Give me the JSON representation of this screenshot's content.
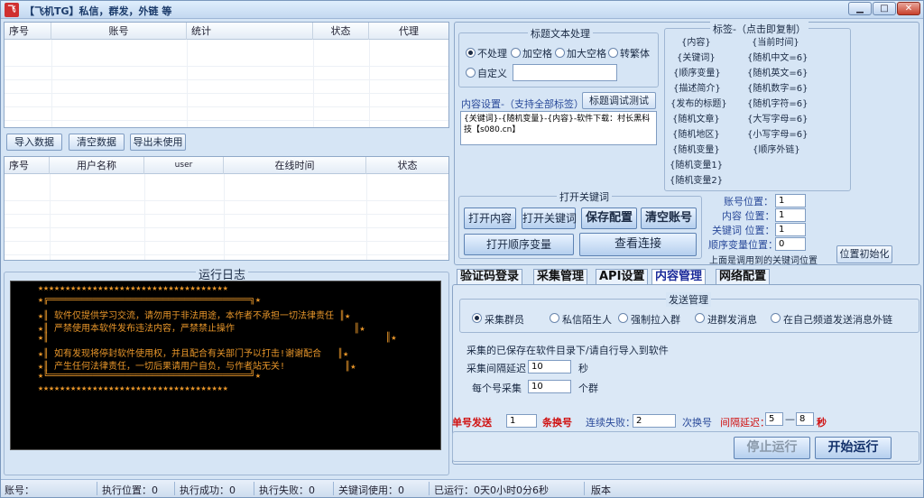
{
  "window": {
    "title": "【飞机TG】私信，群发，外链 等",
    "icon": "飞",
    "min": "▁",
    "max": "□",
    "close": "✕"
  },
  "grid1": {
    "columns": [
      "序号",
      "账号",
      "统计",
      "状态",
      "代理"
    ]
  },
  "grid1_buttons": {
    "import": "导入数据",
    "clear": "清空数据",
    "export": "导出未使用"
  },
  "grid2": {
    "columns": [
      "序号",
      "用户名称",
      "user",
      "在线时间",
      "状态"
    ]
  },
  "log": {
    "title": "运行日志",
    "lines": [
      "★★★★★★★★★★★★★★★★★★★★★★★★★★★★★★★★★★★",
      "★╔═════════════════════════════════════╗★",
      "★║ 软件仅提供学习交流，请勿用于非法用途，本作者不承担一切法律责任 ║★",
      "★║ 严禁使用本软件发布违法内容，严禁禁止操作                      ║★",
      "★║                                                              ║★",
      "★║ 如有发现将停封软件使用权，并且配合有关部门予以打击!谢谢配合   ║★",
      "★║ 产生任何法律责任，一切后果请用户自负，与作者站无关!           ║★",
      "★╚═════════════════════════════════════╝★",
      "★★★★★★★★★★★★★★★★★★★★★★★★★★★★★★★★★★★"
    ]
  },
  "title_proc": {
    "title": "标题文本处理",
    "opt1": "不处理",
    "opt2": "加空格",
    "opt3": "加大空格",
    "opt4": "转繁体",
    "opt5": "自定义",
    "custom_value": ""
  },
  "content": {
    "label": "内容设置-（支持全部标签）",
    "test_btn": "标题调试测试",
    "text": "{关键词}-{随机变量}-{内容}-软件下载：村长黑科技【s080.cn】"
  },
  "tags": {
    "title": "标签-（点击即复制）",
    "left": [
      "{内容}",
      "{关键词}",
      "{顺序变量}",
      "{描述简介}",
      "{发布的标题}",
      "{随机文章}",
      "{随机地区}",
      "{随机变量}",
      "{随机变量1}",
      "{随机变量2}"
    ],
    "right": [
      "{当前时间}",
      "{随机中文=6}",
      "{随机英文=6}",
      "{随机数字=6}",
      "{随机字符=6}",
      "{大写字母=6}",
      "{小写字母=6}",
      "{顺序外链}"
    ]
  },
  "keywords": {
    "title": "打开关键词",
    "open_content": "打开内容",
    "open_keyword": "打开关键词",
    "save_config": "保存配置",
    "clear_account": "清空账号",
    "open_seq": "打开顺序变量",
    "view_link": "查看连接"
  },
  "positions": {
    "account_label": "账号位置：",
    "account_val": "1",
    "content_label": "内容 位置：",
    "content_val": "1",
    "keyword_label": "关键词 位置：",
    "keyword_val": "1",
    "seq_label": "顺序变量位置：",
    "seq_val": "0",
    "note": "上面是调用到的关键词位置",
    "init_btn": "位置初始化"
  },
  "tabs": [
    "验证码登录",
    "采集管理",
    "API设置",
    "内容管理",
    "网络配置"
  ],
  "send": {
    "title": "发送管理",
    "r1": "采集群员",
    "r2": "私信陌生人",
    "r3": "强制拉入群",
    "r4": "进群发消息",
    "r5": "在自己频道发送消息外链",
    "note": "采集的已保存在软件目录下/请自行导入到软件",
    "delay_label": "采集间隔延迟",
    "delay_val": "10",
    "delay_unit": "秒",
    "per_label": "每个号采集",
    "per_val": "10",
    "per_unit": "个群"
  },
  "bottom": {
    "single_label": "单号发送",
    "single_val": "1",
    "switch_label": "条换号",
    "fail_label": "连续失败：",
    "fail_val": "2",
    "fail_unit": "次换号",
    "interval_label": "间隔延迟：",
    "interval_min": "5",
    "interval_dash": "—",
    "interval_max": "8",
    "interval_unit": "秒",
    "stop": "停止运行",
    "start": "开始运行"
  },
  "status": {
    "account": "账号：",
    "exec_pos": "执行位置：0",
    "exec_ok": "执行成功：0",
    "exec_fail": "执行失败：0",
    "kw_used": "关键词使用：0",
    "running": "已运行：0天0小时0分6秒",
    "version": "版本"
  }
}
